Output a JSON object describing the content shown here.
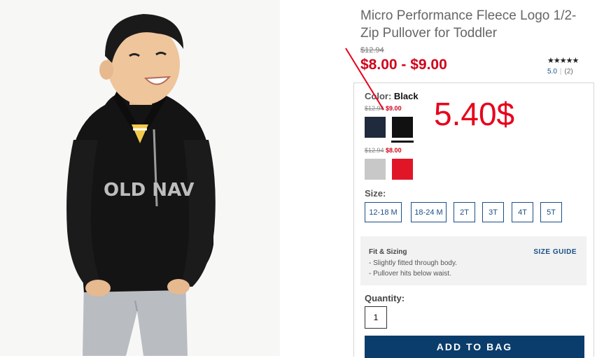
{
  "product": {
    "title": "Micro Performance Fleece Logo 1/2-Zip Pullover for Toddler",
    "original_price": "$12.94",
    "sale_price": "$8.00 - $9.00",
    "rating": {
      "stars": "★★★★★",
      "score": "5.0",
      "count": "(2)"
    },
    "photo_text": "OLD NAV"
  },
  "color": {
    "label": "Color:",
    "selected": "Black",
    "groups": [
      {
        "was": "$12.94",
        "now": "$9.00",
        "swatches": [
          {
            "name": "Navy",
            "hex": "#1f2a3c"
          },
          {
            "name": "Black",
            "hex": "#111111",
            "selected": true
          }
        ]
      },
      {
        "was": "$12.94",
        "now": "$8.00",
        "swatches": [
          {
            "name": "Heather Gray",
            "hex": "#c8c8c8"
          },
          {
            "name": "Red",
            "hex": "#e01628"
          }
        ]
      }
    ]
  },
  "size": {
    "label": "Size:",
    "options": [
      "12-18 M",
      "18-24 M",
      "2T",
      "3T",
      "4T",
      "5T"
    ]
  },
  "fit": {
    "title": "Fit & Sizing",
    "guide_link": "SIZE GUIDE",
    "lines": [
      "- Slightly fitted through body.",
      "- Pullover hits below waist."
    ]
  },
  "quantity": {
    "label": "Quantity:",
    "value": "1"
  },
  "add_to_bag": "ADD TO BAG",
  "annotation": {
    "text": "5.40$",
    "color": "#e8001c"
  }
}
